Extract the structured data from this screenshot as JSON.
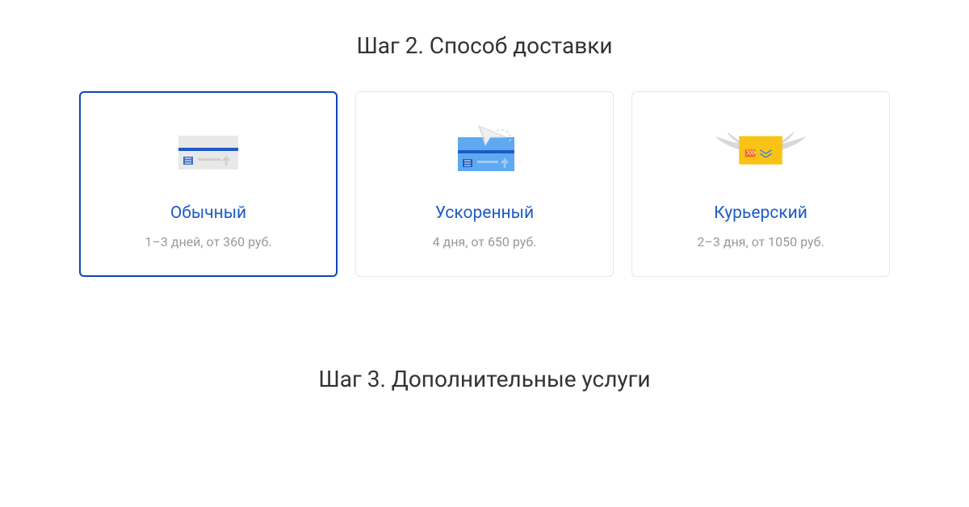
{
  "step2": {
    "title": "Шаг 2. Способ доставки",
    "options": [
      {
        "name": "Обычный",
        "subtitle": "1–3 дней, от 360 руб.",
        "selected": true,
        "icon": "standard-envelope-icon"
      },
      {
        "name": "Ускоренный",
        "subtitle": "4 дня, от 650 руб.",
        "selected": false,
        "icon": "express-envelope-icon"
      },
      {
        "name": "Курьерский",
        "subtitle": "2–3 дня, от 1050 руб.",
        "selected": false,
        "icon": "courier-envelope-icon"
      }
    ]
  },
  "step3": {
    "title": "Шаг 3. Дополнительные услуги"
  },
  "colors": {
    "accent": "#1e5bc6",
    "selectedBorder": "#1046b2",
    "muted": "#999",
    "cardBorder": "#e6e6e6"
  }
}
